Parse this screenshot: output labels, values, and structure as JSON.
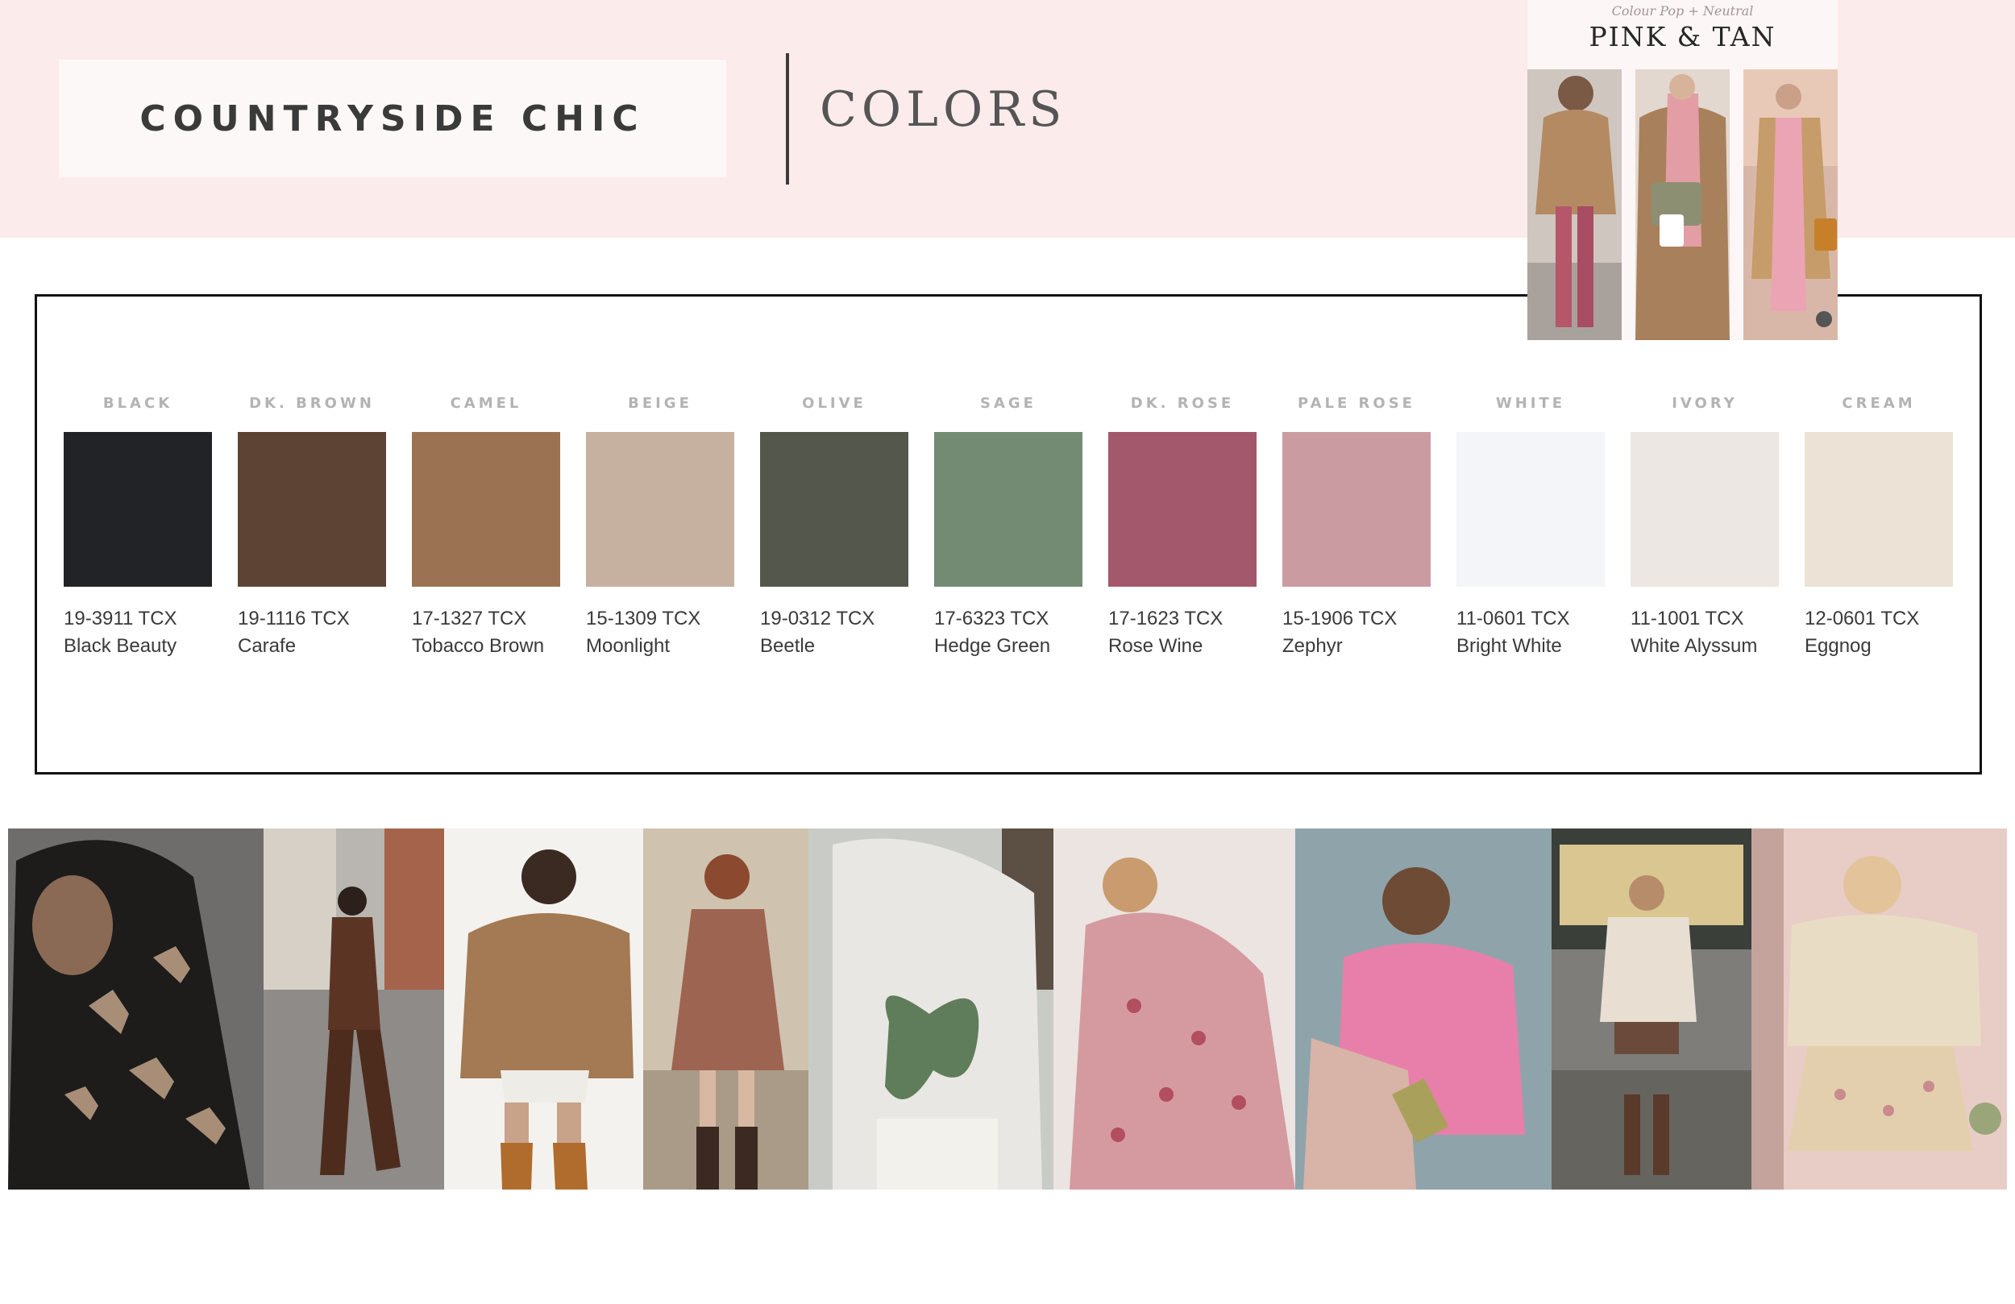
{
  "header": {
    "title": "COUNTRYSIDE CHIC",
    "section": "COLORS"
  },
  "moodboard": {
    "subtitle": "Colour Pop + Neutral",
    "title": "PINK & TAN"
  },
  "palette": {
    "swatches": [
      {
        "name": "BLACK",
        "code": "19-3911 TCX",
        "label": "Black Beauty",
        "color": "#222327"
      },
      {
        "name": "DK. BROWN",
        "code": "19-1116 TCX",
        "label": "Carafe",
        "color": "#5d4334"
      },
      {
        "name": "CAMEL",
        "code": "17-1327 TCX",
        "label": "Tobacco Brown",
        "color": "#9b7352"
      },
      {
        "name": "BEIGE",
        "code": "15-1309 TCX",
        "label": "Moonlight",
        "color": "#c6b09f"
      },
      {
        "name": "OLIVE",
        "code": "19-0312 TCX",
        "label": "Beetle",
        "color": "#54584c"
      },
      {
        "name": "SAGE",
        "code": "17-6323 TCX",
        "label": "Hedge Green",
        "color": "#738a73"
      },
      {
        "name": "DK. ROSE",
        "code": "17-1623 TCX",
        "label": "Rose Wine",
        "color": "#a3586b"
      },
      {
        "name": "PALE ROSE",
        "code": "15-1906 TCX",
        "label": "Zephyr",
        "color": "#cb9ba2"
      },
      {
        "name": "WHITE",
        "code": "11-0601 TCX",
        "label": "Bright White",
        "color": "#f4f5f9"
      },
      {
        "name": "IVORY",
        "code": "11-1001 TCX",
        "label": "White Alyssum",
        "color": "#ece7e3"
      },
      {
        "name": "CREAM",
        "code": "12-0601 TCX",
        "label": "Eggnog",
        "color": "#ece2d5"
      }
    ]
  }
}
